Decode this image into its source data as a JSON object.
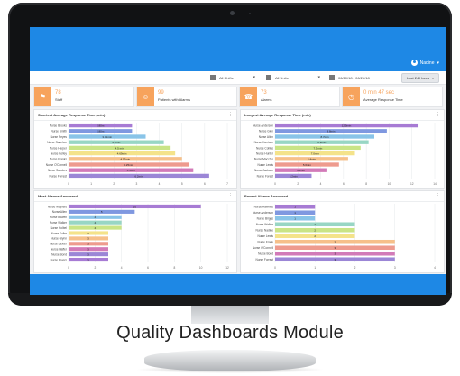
{
  "caption": "Quality Dashboards Module",
  "header": {
    "user_label": "Nadine"
  },
  "filters": {
    "shifts": "All Shifts",
    "units": "All Units",
    "date_range": "06/20/18 - 06/21/18",
    "last_button": "Last 24 Hours"
  },
  "kpis": [
    {
      "value": "78",
      "label": "Staff",
      "icon": "flag-icon"
    },
    {
      "value": "99",
      "label": "Patients with Alarms",
      "icon": "people-icon"
    },
    {
      "value": "73",
      "label": "Alarms",
      "icon": "phone-icon"
    },
    {
      "value": "0 min 47 sec",
      "label": "Average Response Time",
      "icon": "clock-icon"
    }
  ],
  "colors": {
    "app_blue": "#1e88e5",
    "accent_orange": "#f7a35c",
    "bars": [
      "#a77bd4",
      "#7f98e0",
      "#89c4e8",
      "#98d6c4",
      "#c9e486",
      "#f4e38a",
      "#f6c08a",
      "#ee9b8e",
      "#d27ab8",
      "#9b86d6"
    ]
  },
  "chart_data": [
    {
      "type": "bar",
      "title": "Shortest Average Response Time (min)",
      "orientation": "horizontal",
      "categories": [
        "Nurse Brooks",
        "Nurse Smith",
        "Nurse Reyes",
        "Nurse Sanchez",
        "Nurse Harper",
        "Nurse Kelley",
        "Nurse Franks",
        "Nurse O'Connell",
        "Nurse Sanders",
        "Nurse Forrest"
      ],
      "values": [
        2.8,
        2.8,
        3.4,
        4.2,
        4.5,
        4.7,
        5.0,
        5.3,
        5.5,
        6.2
      ],
      "data_labels": [
        "2.80m",
        "2.80m",
        "3.41min",
        "4.2min",
        "4.5 min",
        "4.69min",
        "4.97min",
        "5.25min",
        "5.5min",
        "6.2min"
      ],
      "xlim": [
        0,
        7
      ],
      "xticks": [
        "0",
        "1",
        "2",
        "3",
        "4",
        "5",
        "6",
        "7"
      ]
    },
    {
      "type": "bar",
      "title": "Longest Average Response Time (min)",
      "orientation": "horizontal",
      "categories": [
        "Nurse Anderson",
        "Nurse Glen",
        "Nurse Allen",
        "Nurse Harrison",
        "Nurse Collins",
        "Nurse Hunter",
        "Nurse Macchio",
        "Nurse Lewis",
        "Nurse Jackson",
        "Nurse Forest"
      ],
      "values": [
        12.5,
        9.8,
        8.7,
        8.2,
        7.5,
        7.0,
        6.4,
        5.6,
        4.5,
        3.2
      ],
      "data_labels": [
        "12.5min",
        "9.8min",
        "8.7min",
        "8.2min",
        "7.5 min",
        "7.0min",
        "6.4min",
        "5.6min",
        "4.5min",
        "3.2min"
      ],
      "xlim": [
        0,
        14
      ],
      "xticks": [
        "0",
        "2",
        "4",
        "6",
        "8",
        "10",
        "12",
        "14"
      ]
    },
    {
      "type": "bar",
      "title": "Most Alarms Answered",
      "orientation": "horizontal",
      "categories": [
        "Nurse Mayfield",
        "Nurse Allen",
        "Nurse Bowen",
        "Nurse Walker",
        "Nurse Holbel",
        "Nurse Fuller",
        "Nurse Glynn",
        "Nurse Dexter",
        "Nurse Haffer",
        "Nurse Bond",
        "Nurse Rivers"
      ],
      "values": [
        10,
        5,
        4,
        4,
        4,
        3,
        3,
        3,
        3,
        3,
        3
      ],
      "data_labels": [
        "10",
        "5",
        "4",
        "4",
        "4",
        "3",
        "3",
        "3",
        "3",
        "3",
        "3"
      ],
      "xlim": [
        0,
        12
      ],
      "xticks": [
        "0",
        "2",
        "4",
        "6",
        "8",
        "10",
        "12"
      ]
    },
    {
      "type": "bar",
      "title": "Fewest Alarms Answered",
      "orientation": "horizontal",
      "categories": [
        "Nurse Hawkins",
        "Nurse Anderson",
        "Nurse Briggs",
        "Nurse Walker",
        "Nurse Nadine",
        "Nurse Lewis",
        "Nurse Frank",
        "Nurse O'Connell",
        "Nurse Bond",
        "Nurse Forrest"
      ],
      "values": [
        1,
        1,
        1,
        2,
        2,
        2,
        3,
        3,
        3,
        3
      ],
      "data_labels": [
        "1",
        "1",
        "1",
        "2",
        "2",
        "2",
        "3",
        "3",
        "3",
        "3"
      ],
      "xlim": [
        0,
        4
      ],
      "xticks": [
        "0",
        "1",
        "2",
        "3",
        "4"
      ]
    }
  ]
}
